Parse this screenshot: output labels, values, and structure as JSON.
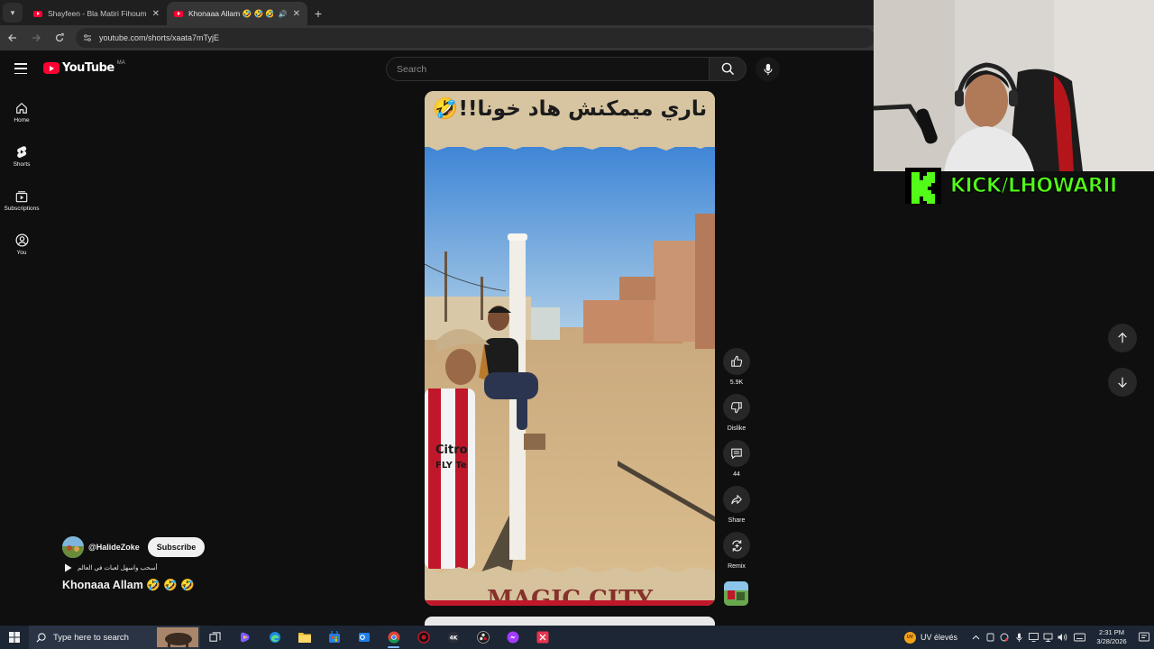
{
  "browser": {
    "tabs": [
      {
        "title": "Shayfeen - Bla Matiri Fihoum (B",
        "active": false
      },
      {
        "title": "Khonaaa Allam 🤣 🤣 🤣 - Y",
        "active": true
      }
    ],
    "url": "youtube.com/shorts/xaata7mTyjE"
  },
  "masthead": {
    "logo_text": "YouTube",
    "country_code": "MA",
    "search_placeholder": "Search"
  },
  "guide": [
    {
      "label": "Home",
      "icon": "home-icon"
    },
    {
      "label": "Shorts",
      "icon": "shorts-icon"
    },
    {
      "label": "Subscriptions",
      "icon": "subscriptions-icon"
    },
    {
      "label": "You",
      "icon": "you-icon"
    }
  ],
  "short": {
    "overlay_caption": "ناري ميمكنش هاد خونا!!🤣",
    "channel_handle": "@HalideZoke",
    "subscribe_label": "Subscribe",
    "sound_text": "أسحب واسهل لعبات في العالم",
    "title": "Khonaaa Allam 🤣 🤣 🤣"
  },
  "actions": {
    "like_count": "5.9K",
    "dislike_label": "Dislike",
    "comment_count": "44",
    "share_label": "Share",
    "remix_label": "Remix"
  },
  "stream_overlay": {
    "kick_text": "KICK/LHOWARII"
  },
  "taskbar": {
    "search_placeholder": "Type here to search",
    "weather_text": "UV élevés",
    "time": "2:31 PM",
    "date": "3/28/2026"
  },
  "colors": {
    "youtube_red": "#ff0033",
    "kick_green": "#53fc18",
    "background": "#0f0f0f"
  }
}
